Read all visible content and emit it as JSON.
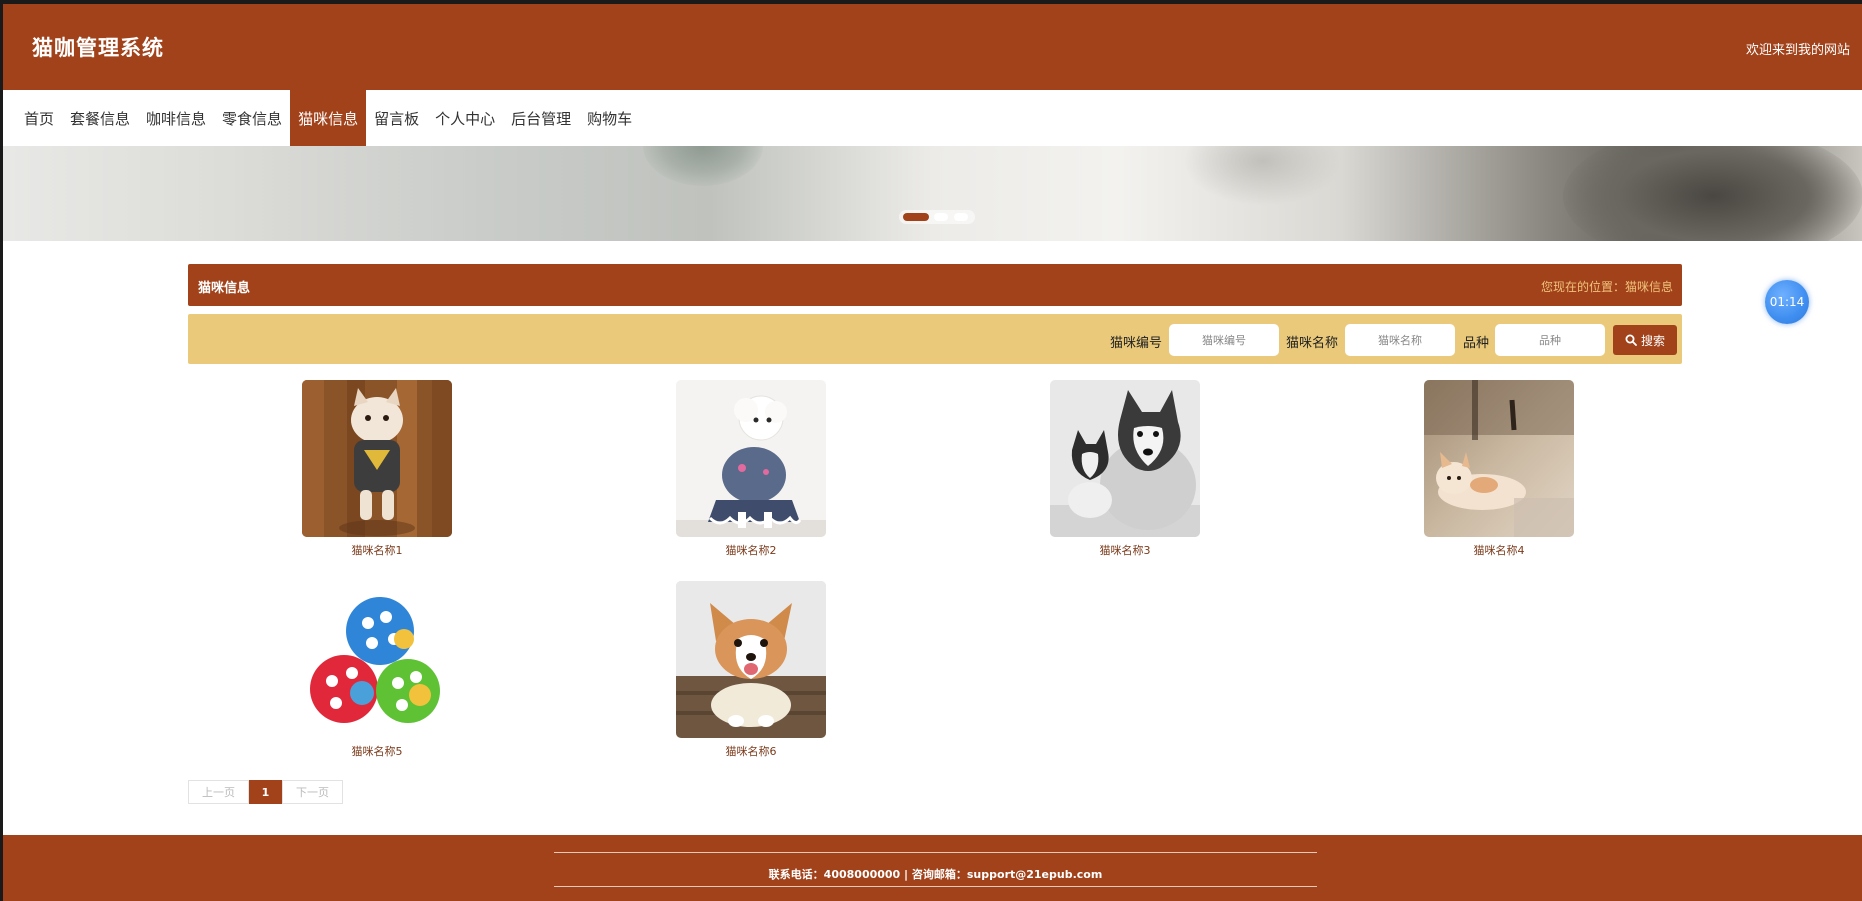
{
  "header": {
    "site_title": "猫咖管理系统",
    "welcome": "欢迎来到我的网站"
  },
  "nav": {
    "items": [
      "首页",
      "套餐信息",
      "咖啡信息",
      "零食信息",
      "猫咪信息",
      "留言板",
      "个人中心",
      "后台管理",
      "购物车"
    ],
    "active": "猫咪信息"
  },
  "banner": {
    "slides": 3,
    "active_slide": 1
  },
  "section": {
    "title": "猫咪信息",
    "location": "您现在的位置：猫咪信息"
  },
  "search": {
    "id_label": "猫咪编号",
    "id_placeholder": "猫咪编号",
    "name_label": "猫咪名称",
    "name_placeholder": "猫咪名称",
    "breed_label": "品种",
    "breed_placeholder": "品种",
    "button_label": "搜索"
  },
  "cards": [
    {
      "name": "猫咪名称1"
    },
    {
      "name": "猫咪名称2"
    },
    {
      "name": "猫咪名称3"
    },
    {
      "name": "猫咪名称4"
    },
    {
      "name": "猫咪名称5"
    },
    {
      "name": "猫咪名称6"
    }
  ],
  "pagination": {
    "prev": "上一页",
    "current": "1",
    "next": "下一页"
  },
  "footer": {
    "contact": "联系电话：4008000000 | 咨询邮箱：support@21epub.com"
  },
  "timer": {
    "value": "01:14"
  },
  "colors": {
    "brand": "#a1421b",
    "search_bar": "#eaca7a",
    "timer": "#3e8ef0"
  }
}
